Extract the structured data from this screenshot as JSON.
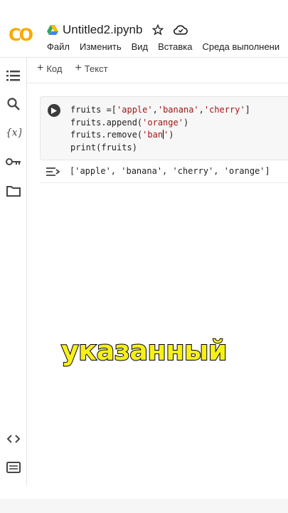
{
  "header": {
    "logo_text": "CO",
    "doc_title": "Untitled2.ipynb",
    "menu": [
      "Файл",
      "Изменить",
      "Вид",
      "Вставка",
      "Среда выполнени"
    ]
  },
  "toolbar": {
    "add_code_label": "Код",
    "add_text_label": "Текст"
  },
  "sidebar": {
    "icons": [
      "table-of-contents-icon",
      "search-icon",
      "variables-icon",
      "key-icon",
      "folder-icon",
      "code-snippets-icon",
      "terminal-icon"
    ]
  },
  "cell": {
    "code_lines": [
      "fruits =['apple','banana','cherry']",
      "fruits.append('orange')",
      "fruits.remove('ban')",
      "print(fruits)"
    ],
    "output": "['apple', 'banana', 'cherry', 'orange']"
  },
  "caption": "указанный",
  "colors": {
    "logo_orange": "#f9ab00",
    "string_red": "#a31515",
    "caption_yellow": "#f7ef1a"
  }
}
